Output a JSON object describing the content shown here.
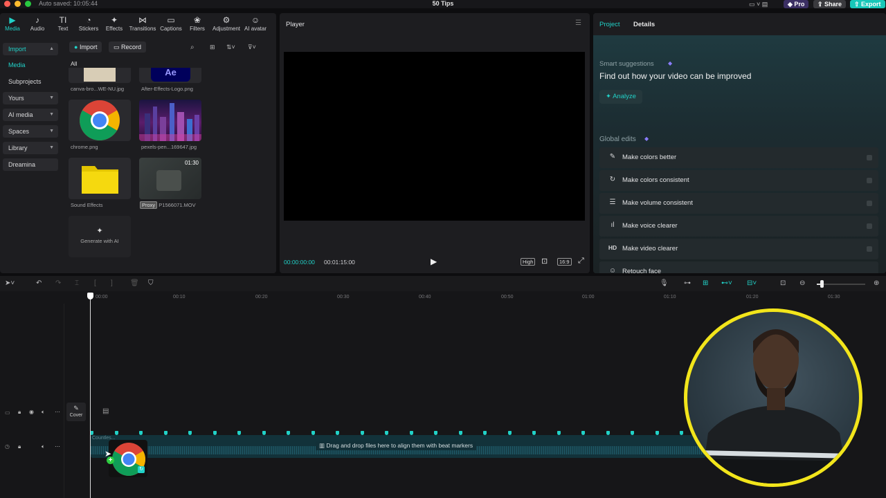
{
  "titlebar": {
    "autosave": "Auto saved: 10:05:44",
    "title": "50 Tips",
    "pro_label": "Pro",
    "share_label": "Share",
    "export_label": "Export"
  },
  "toolbar": {
    "tools": [
      {
        "label": "Media",
        "icon": "▶"
      },
      {
        "label": "Audio",
        "icon": "♪"
      },
      {
        "label": "Text",
        "icon": "TI"
      },
      {
        "label": "Stickers",
        "icon": "◔"
      },
      {
        "label": "Effects",
        "icon": "✦"
      },
      {
        "label": "Transitions",
        "icon": "⋈"
      },
      {
        "label": "Captions",
        "icon": "▭"
      },
      {
        "label": "Filters",
        "icon": "❀"
      },
      {
        "label": "Adjustment",
        "icon": "⚙"
      },
      {
        "label": "AI avatar",
        "icon": "☺"
      }
    ]
  },
  "sidebar": {
    "items": [
      {
        "label": "Import"
      },
      {
        "label": "Media"
      },
      {
        "label": "Subprojects"
      },
      {
        "label": "Yours"
      },
      {
        "label": "AI media"
      },
      {
        "label": "Spaces"
      },
      {
        "label": "Library"
      },
      {
        "label": "Dreamina"
      }
    ]
  },
  "media": {
    "import_label": "Import",
    "record_label": "Record",
    "filter_all": "All",
    "items": [
      {
        "name": "canva-bro...WE-NU.jpg"
      },
      {
        "name": "After-Effects-Logo.png",
        "thumb_text": "Ae"
      },
      {
        "name": "chrome.png"
      },
      {
        "name": "pexels-pen...169647.jpg"
      },
      {
        "name": "Sound Effects"
      },
      {
        "name": "P1566071.MOV",
        "duration": "01:30",
        "badge": "Proxy"
      }
    ],
    "generate_label": "Generate with AI"
  },
  "player": {
    "title": "Player",
    "current_time": "00:00:00:00",
    "total_time": "00:01:15:00",
    "quality": "High",
    "ratio": "16:9"
  },
  "right_panel": {
    "tabs": [
      {
        "label": "Project"
      },
      {
        "label": "Details"
      }
    ],
    "smart_title": "Smart suggestions",
    "smart_heading": "Find out how your video can be improved",
    "analyze_label": "Analyze",
    "global_title": "Global edits",
    "global_items": [
      {
        "label": "Make colors better",
        "icon": "✎"
      },
      {
        "label": "Make colors consistent",
        "icon": "↻"
      },
      {
        "label": "Make volume consistent",
        "icon": "☰"
      },
      {
        "label": "Make voice clearer",
        "icon": "ıl"
      },
      {
        "label": "Make video clearer",
        "icon": "HD"
      },
      {
        "label": "Retouch face",
        "icon": "☺"
      }
    ]
  },
  "timeline": {
    "ticks": [
      "00:00",
      "00:10",
      "00:20",
      "00:30",
      "00:40",
      "00:50",
      "01:00",
      "01:10",
      "01:20",
      "01:30"
    ],
    "cover_label": "Cover",
    "audio_track_label": "Countles...",
    "dropzone_text": "Drag and drop files here to align them with beat markers"
  },
  "colors": {
    "accent": "#21d2c8",
    "export": "#17c7b8",
    "share": "#3a3a3e",
    "pro": "#3b2f63",
    "camera_ring": "#f2e51b"
  }
}
